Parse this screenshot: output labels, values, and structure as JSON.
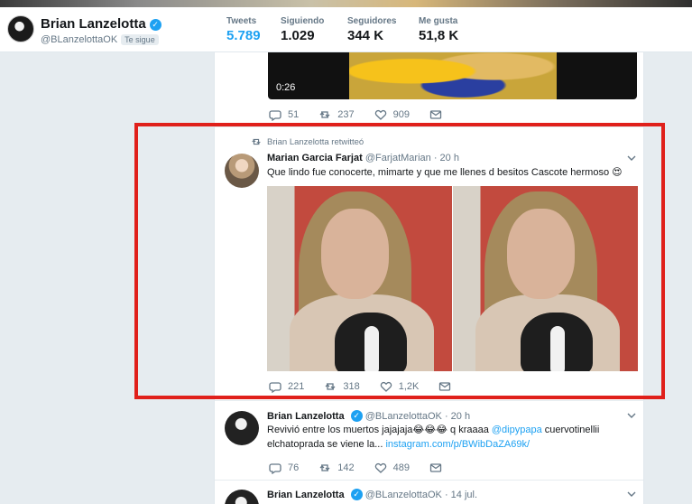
{
  "profile": {
    "name": "Brian Lanzelotta",
    "handle": "@BLanzelottaOK",
    "follows_you": "Te sigue",
    "verified_glyph": "✓",
    "stats": [
      {
        "label": "Tweets",
        "value": "5.789",
        "active": true
      },
      {
        "label": "Siguiendo",
        "value": "1.029"
      },
      {
        "label": "Seguidores",
        "value": "344 K"
      },
      {
        "label": "Me gusta",
        "value": "51,8 K"
      }
    ]
  },
  "video_tweet": {
    "duration": "0:26",
    "replies": "51",
    "retweets": "237",
    "likes": "909"
  },
  "retweet": {
    "context": "Brian Lanzelotta retwitteó",
    "author_name": "Marian Garcia Farjat",
    "author_handle": "@FarjatMarian",
    "time": "· 20 h",
    "text": "Que lindo fue conocerte, mimarte y que me llenes d besitos Cascote hermoso 😍",
    "replies": "221",
    "retweets": "318",
    "likes": "1,2K"
  },
  "tweet2": {
    "author_name": "Brian Lanzelotta",
    "author_handle": "@BLanzelottaOK",
    "time": "· 20 h",
    "text_before": "Revivió entre los muertos jajajaja😂😂😂 q kraaaa ",
    "mention": "@dipypapa",
    "text_middle": " cuervotinellii elchatoprada se viene la... ",
    "link": "instagram.com/p/BWibDaZA69k/",
    "replies": "76",
    "retweets": "142",
    "likes": "489"
  },
  "tweet3": {
    "author_name": "Brian Lanzelotta",
    "author_handle": "@BLanzelottaOK",
    "time": "· 14 jul."
  },
  "colors": {
    "accent": "#1da1f2",
    "highlight": "#e0201b"
  },
  "icons": [
    "verified-icon",
    "reply-icon",
    "retweet-icon",
    "like-icon",
    "message-icon",
    "chevron-down-icon"
  ]
}
